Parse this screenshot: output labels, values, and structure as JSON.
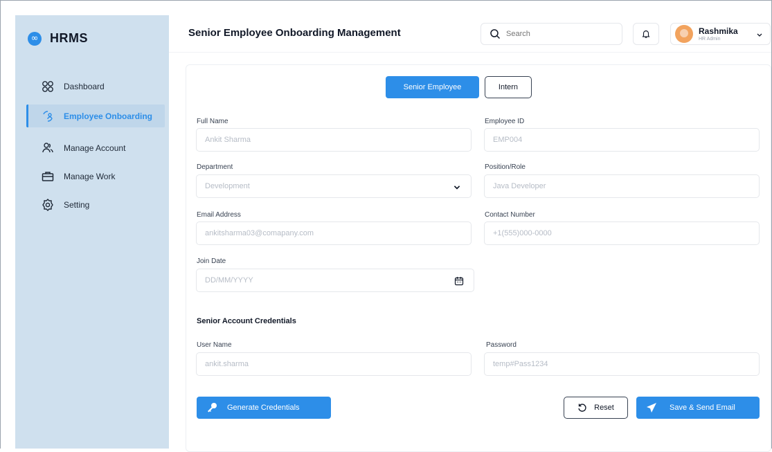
{
  "brand": {
    "badge": "∞",
    "name": "HRMS"
  },
  "nav": [
    {
      "label": "Dashboard",
      "icon": "dashboard-grid-icon",
      "active": false
    },
    {
      "label": "Employee Onboarding",
      "icon": "onboarding-icon",
      "active": true
    },
    {
      "label": "Manage Account",
      "icon": "users-icon",
      "active": false
    },
    {
      "label": "Manage Work",
      "icon": "briefcase-icon",
      "active": false
    },
    {
      "label": "Setting",
      "icon": "gear-icon",
      "active": false
    }
  ],
  "header": {
    "title": "Senior Employee Onboarding Management",
    "search_placeholder": "Search",
    "user_name": "Rashmika",
    "user_role": "HR Admin"
  },
  "toggle": {
    "senior": "Senior Employee",
    "intern": "Intern",
    "selected": "Senior Employee"
  },
  "form": {
    "full_name": {
      "label": "Full Name",
      "placeholder": "Ankit Sharma"
    },
    "employee_id": {
      "label": "Employee ID",
      "placeholder": "EMP004"
    },
    "department": {
      "label": "Department",
      "placeholder": "Development"
    },
    "position": {
      "label": "Position/Role",
      "placeholder": "Java Developer"
    },
    "email": {
      "label": "Email Address",
      "placeholder": "ankitsharma03@comapany.com"
    },
    "contact": {
      "label": "Contact Number",
      "placeholder": "+1(555)000-0000"
    },
    "join_date": {
      "label": "Join Date",
      "placeholder": "DD/MM/YYYY"
    }
  },
  "credentials": {
    "title": "Senior Account Credentials",
    "username": {
      "label": "User Name",
      "placeholder": "ankit.sharma"
    },
    "password": {
      "label": "Password",
      "placeholder": "temp#Pass1234"
    }
  },
  "actions": {
    "generate": "Generate Credentials",
    "reset": "Reset",
    "save": "Save & Send Email"
  },
  "colors": {
    "accent": "#2d8ee8",
    "sidebar_bg": "#cfe0ee"
  }
}
